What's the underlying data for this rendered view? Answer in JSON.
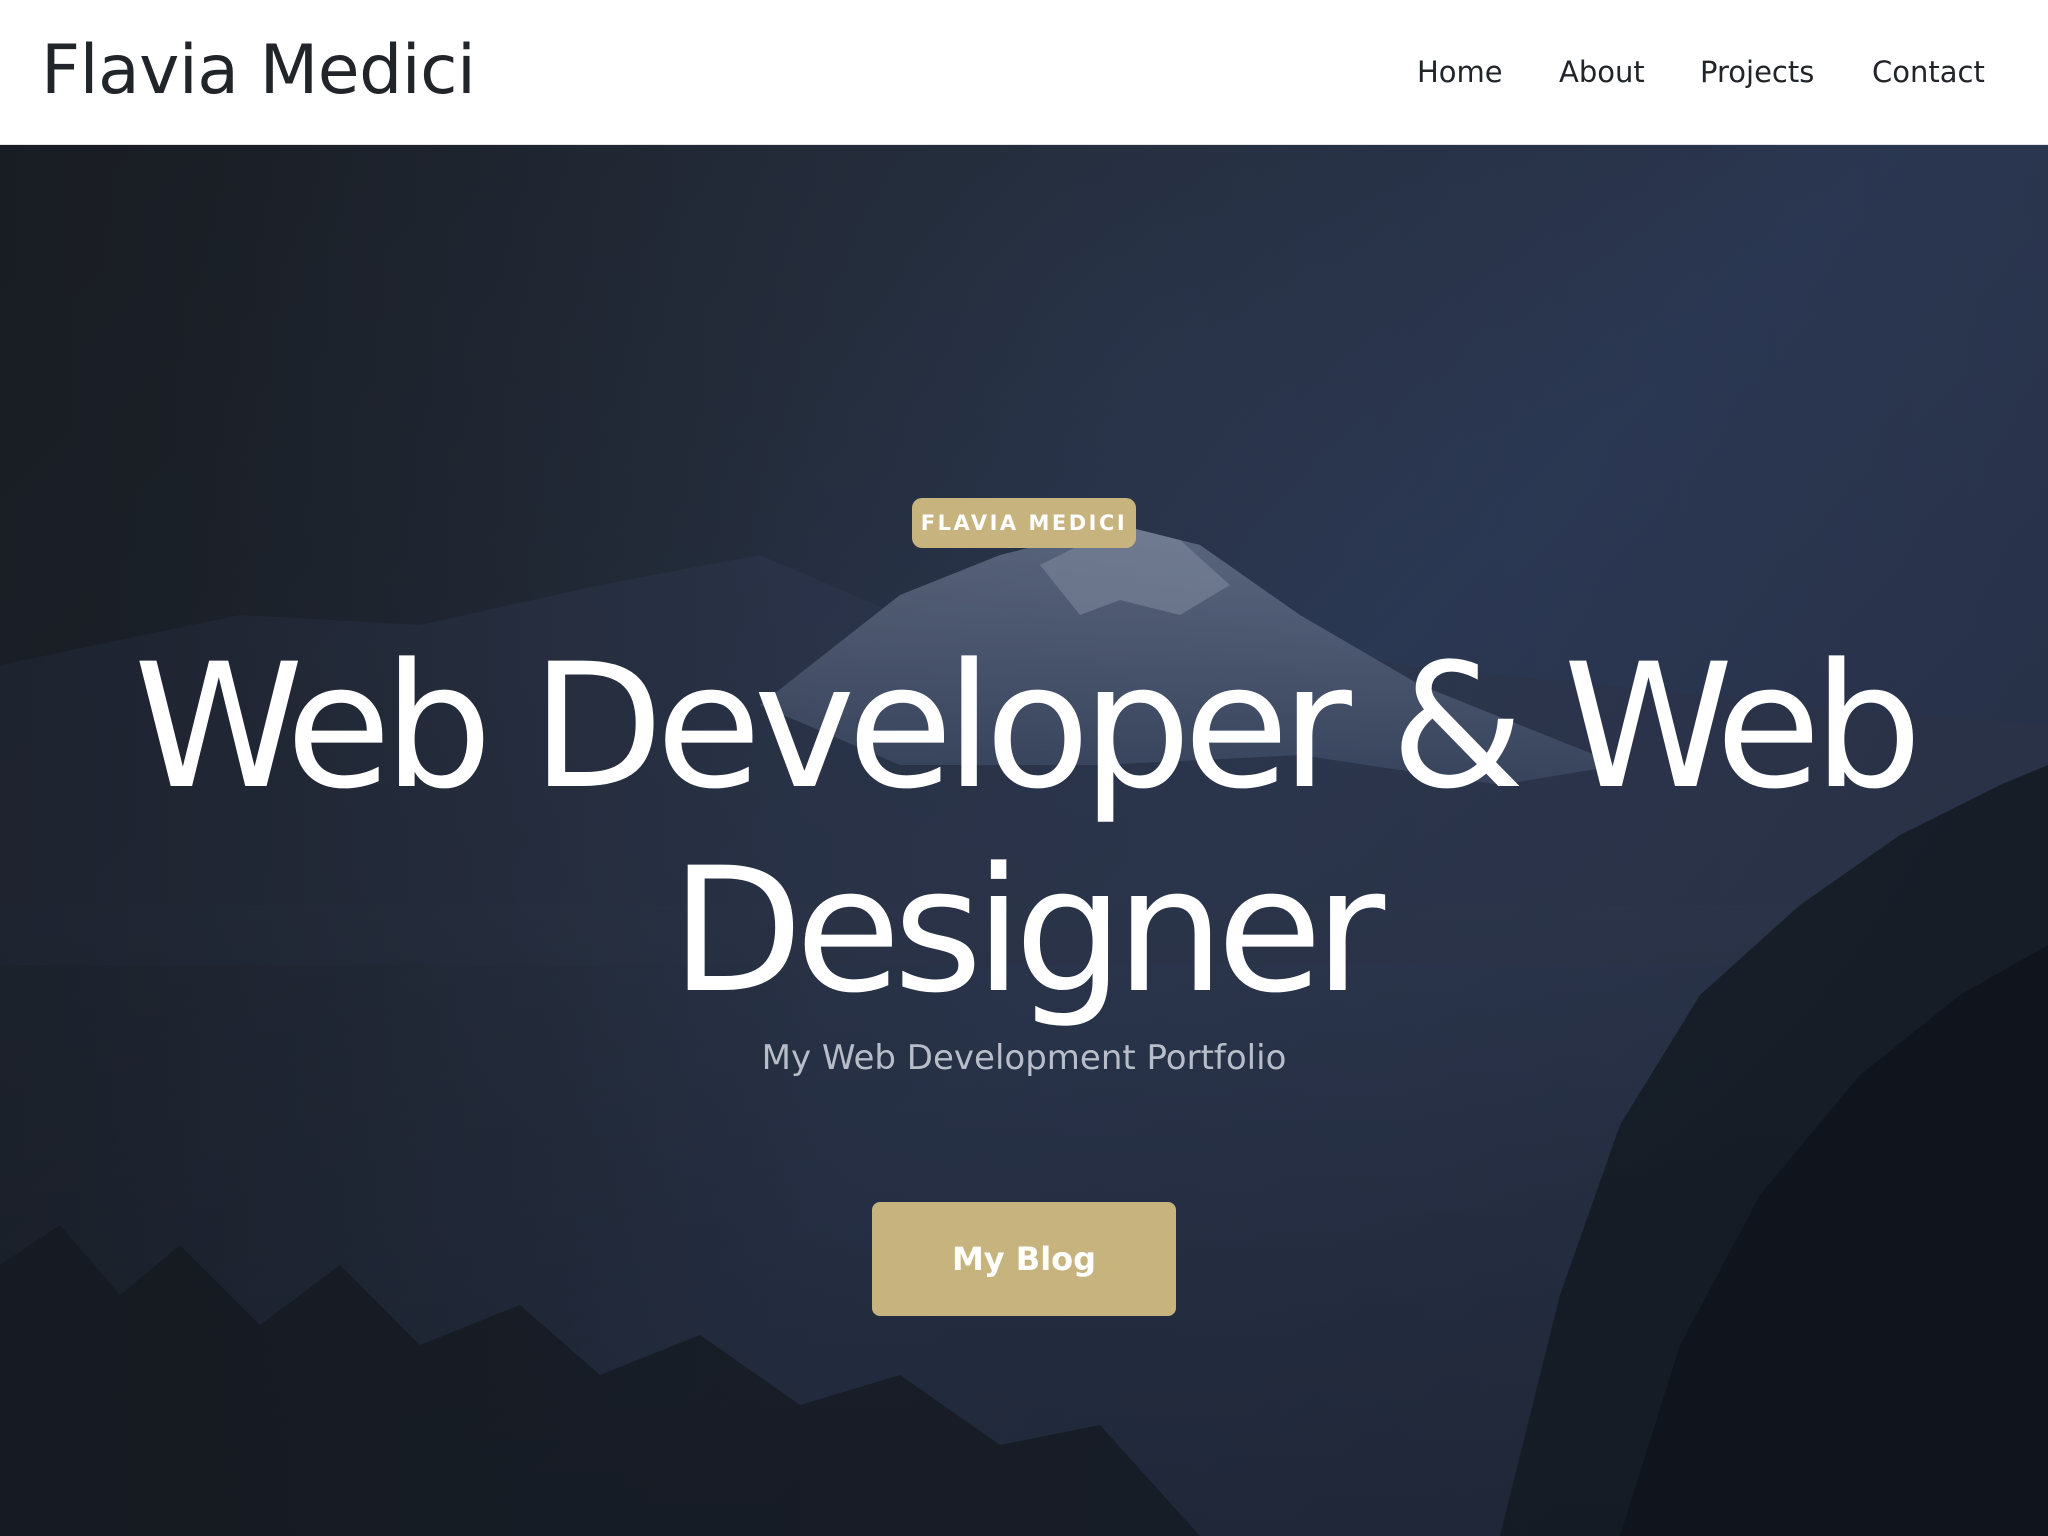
{
  "navbar": {
    "brand": "Flavia Medici",
    "links": [
      {
        "label": "Home"
      },
      {
        "label": "About"
      },
      {
        "label": "Projects"
      },
      {
        "label": "Contact"
      }
    ]
  },
  "hero": {
    "badge": "FLAVIA MEDICI",
    "title_line1": "Web Developer & Web",
    "title_line2": "Designer",
    "subtitle": "My Web Development Portfolio",
    "button_label": "My Blog"
  },
  "colors": {
    "accent": "#c7b37e",
    "hero_bg": "#222935",
    "text_dark": "#212529",
    "text_light": "#ffffff"
  }
}
